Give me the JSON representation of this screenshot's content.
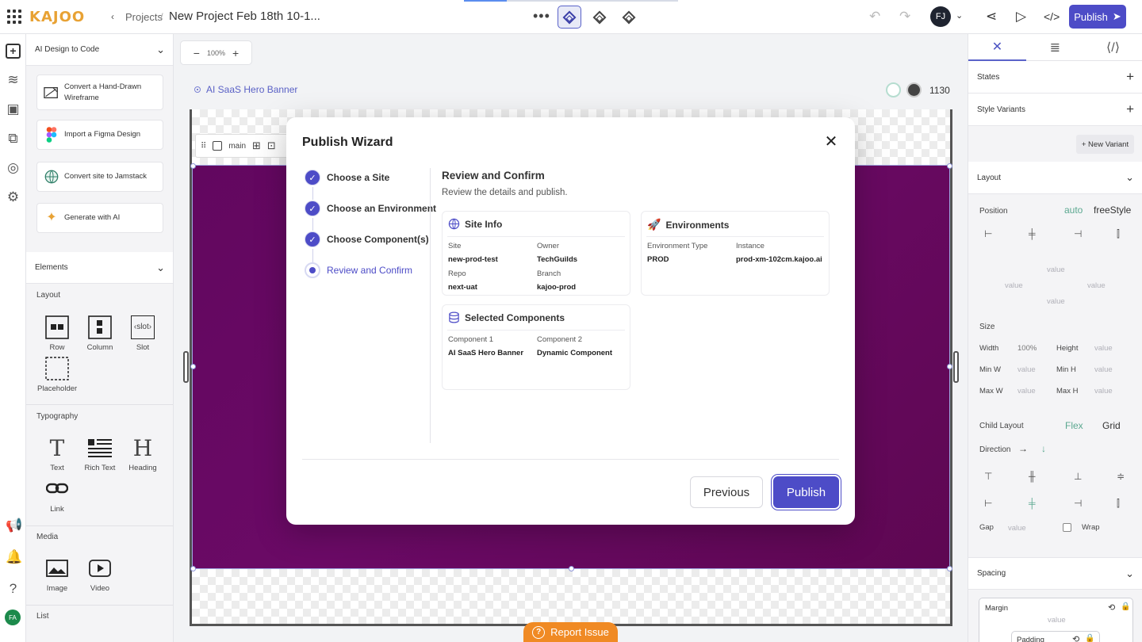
{
  "topbar": {
    "logo": "KAJOO",
    "back_icon": "chevron-left-icon",
    "breadcrumb_projects": "Projects",
    "breadcrumb_sep": "/",
    "project_title": "New Project Feb 18th 10-1...",
    "more_icon": "more-horizontal-icon",
    "avatar_initials": "FJ",
    "publish_label": "Publish",
    "accent_color": "#4d4cc7"
  },
  "left_panel": {
    "ai_dropdown": "AI Design to Code",
    "ai_cards": [
      {
        "label": "Convert a Hand-Drawn Wireframe",
        "icon": "wireframe-icon"
      },
      {
        "label": "Import a Figma Design",
        "icon": "figma-icon"
      },
      {
        "label": "Convert site to Jamstack",
        "icon": "globe-icon"
      },
      {
        "label": "Generate with AI",
        "icon": "sparkle-icon"
      }
    ],
    "elements_header": "Elements",
    "layout_label": "Layout",
    "layout_items": [
      "Row",
      "Column",
      "Slot",
      "Placeholder"
    ],
    "slot_symbol": "‹slot›",
    "typography_label": "Typography",
    "typography_items": [
      "Text",
      "Rich Text",
      "Heading",
      "Link"
    ],
    "media_label": "Media",
    "media_items": [
      "Image",
      "Video"
    ],
    "list_label": "List",
    "user_initials": "FA"
  },
  "canvas": {
    "zoom": "100%",
    "page_name": "AI SaaS Hero Banner",
    "viewport_width": "1130",
    "selection_label": "main",
    "hero_color": "#650860"
  },
  "right_panel": {
    "states_label": "States",
    "style_variants_label": "Style Variants",
    "new_variant_label": "+ New Variant",
    "layout_label": "Layout",
    "position_label": "Position",
    "position_auto": "auto",
    "position_freestyle": "freeStyle",
    "placeholder": "value",
    "size_label": "Size",
    "width_label": "Width",
    "width_value": "100%",
    "height_label": "Height",
    "min_w_label": "Min W",
    "min_h_label": "Min H",
    "max_w_label": "Max W",
    "max_h_label": "Max H",
    "child_layout_label": "Child Layout",
    "flex_label": "Flex",
    "grid_label": "Grid",
    "direction_label": "Direction",
    "gap_label": "Gap",
    "wrap_label": "Wrap",
    "spacing_label": "Spacing",
    "margin_label": "Margin",
    "padding_label": "Padding"
  },
  "modal": {
    "title": "Publish Wizard",
    "steps": [
      {
        "label": "Choose a Site",
        "state": "done"
      },
      {
        "label": "Choose an Environment",
        "state": "done"
      },
      {
        "label": "Choose Component(s)",
        "state": "done"
      },
      {
        "label": "Review and Confirm",
        "state": "current"
      }
    ],
    "review_title": "Review and Confirm",
    "review_subtitle": "Review the details and publish.",
    "site_info": {
      "heading": "Site Info",
      "site_label": "Site",
      "site_value": "new-prod-test",
      "owner_label": "Owner",
      "owner_value": "TechGuilds",
      "repo_label": "Repo",
      "repo_value": "next-uat",
      "branch_label": "Branch",
      "branch_value": "kajoo-prod"
    },
    "environments": {
      "heading": "Environments",
      "env_type_label": "Environment Type",
      "env_type_value": "PROD",
      "instance_label": "Instance",
      "instance_value": "prod-xm-102cm.kajoo.ai"
    },
    "selected_components": {
      "heading": "Selected Components",
      "c1_label": "Component 1",
      "c1_value": "AI SaaS Hero Banner",
      "c2_label": "Component 2",
      "c2_value": "Dynamic Component"
    },
    "previous_label": "Previous",
    "publish_label": "Publish"
  },
  "report_issue_label": "Report Issue"
}
